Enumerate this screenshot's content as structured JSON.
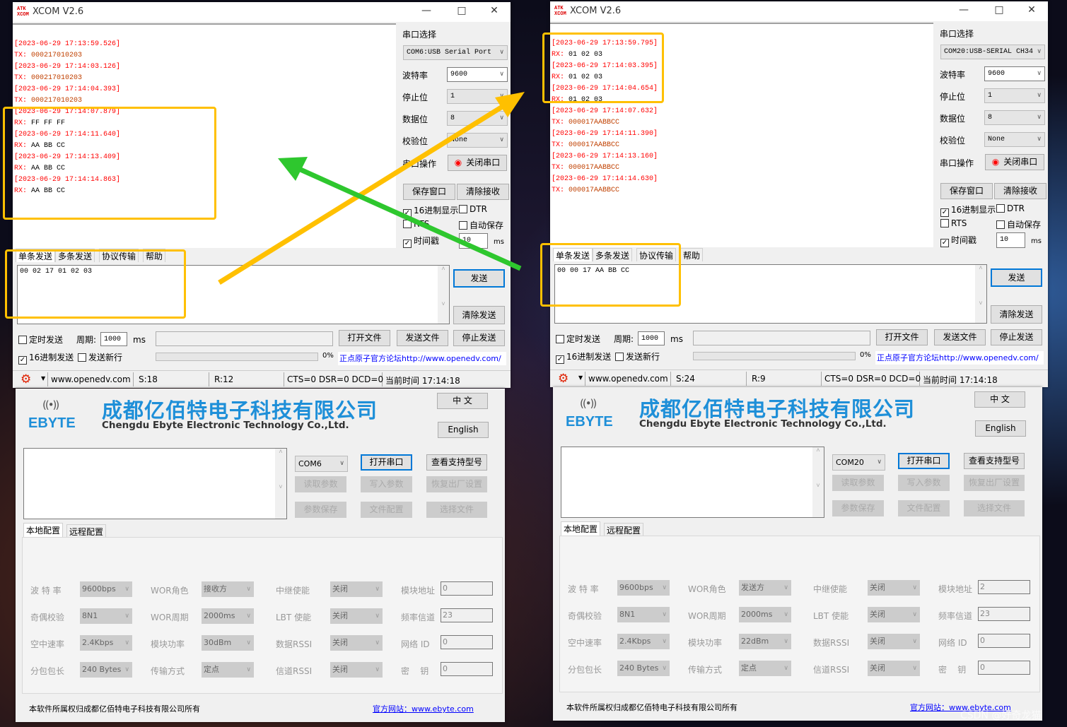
{
  "windows": [
    {
      "xcom": {
        "title": "XCOM V2.6",
        "icon_text": "ATK XCOM",
        "log": [
          {
            "ts": "[2023-06-29 17:13:59.526]",
            "dir": "TX:",
            "payload": "000217010203"
          },
          {
            "ts": "[2023-06-29 17:14:03.126]",
            "dir": "TX:",
            "payload": "000217010203"
          },
          {
            "ts": "[2023-06-29 17:14:04.393]",
            "dir": "TX:",
            "payload": "000217010203"
          },
          {
            "ts": "[2023-06-29 17:14:07.879]",
            "dir": "RX:",
            "payload": "FF FF FF"
          },
          {
            "ts": "[2023-06-29 17:14:11.640]",
            "dir": "RX:",
            "payload": "AA BB CC"
          },
          {
            "ts": "[2023-06-29 17:14:13.409]",
            "dir": "RX:",
            "payload": "AA BB CC"
          },
          {
            "ts": "[2023-06-29 17:14:14.863]",
            "dir": "RX:",
            "payload": "AA BB CC"
          }
        ],
        "panel": {
          "port_label": "串口选择",
          "port": "COM6:USB Serial Port",
          "baud_label": "波特率",
          "baud": "9600",
          "stop_label": "停止位",
          "stop": "1",
          "data_label": "数据位",
          "data": "8",
          "parity_label": "校验位",
          "parity": "None",
          "op_label": "串口操作",
          "op_button": "关闭串口",
          "save_window": "保存窗口",
          "clear_recv": "清除接收",
          "hex_display": "16进制显示",
          "dtr": "DTR",
          "rts": "RTS",
          "auto_save": "自动保存",
          "timestamp": "时间戳",
          "interval": "10",
          "ms": "ms"
        },
        "tabs": [
          "单条发送",
          "多条发送",
          "协议传输",
          "帮助"
        ],
        "send_text": "00 02 17 01 02 03",
        "send_button": "发送",
        "clear_send": "清除发送",
        "timed_send": "定时发送",
        "period_label": "周期:",
        "period": "1000",
        "period_unit": "ms",
        "open_file": "打开文件",
        "send_file": "发送文件",
        "stop_send": "停止发送",
        "hex_send": "16进制发送",
        "send_newline": "发送新行",
        "progress": "0%",
        "forum_link": "正点原子官方论坛http://www.openedv.com/",
        "status": {
          "site": "www.openedv.com",
          "sent": "S:18",
          "recv": "R:12",
          "lines": "CTS=0 DSR=0 DCD=0",
          "time": "当前时间 17:14:18"
        }
      },
      "ebyte": {
        "logo": "EBYTE",
        "company_cn": "成都亿佰特电子科技有限公司",
        "company_en": "Chengdu Ebyte Electronic Technology Co.,Ltd.",
        "lang_cn": "中 文",
        "lang_en": "English",
        "com": "COM6",
        "open_port": "打开串口",
        "view_models": "查看支持型号",
        "read_params": "读取参数",
        "write_params": "写入参数",
        "factory_reset": "恢复出厂设置",
        "save_params": "参数保存",
        "file_config": "文件配置",
        "select_file": "选择文件",
        "tabs": [
          "本地配置",
          "远程配置"
        ],
        "grid": [
          [
            {
              "label": "波 特 率",
              "value": "9600bps"
            },
            {
              "label": "WOR角色",
              "value": "接收方"
            },
            {
              "label": "中继使能",
              "value": "关闭"
            },
            {
              "label": "模块地址",
              "input": "0"
            }
          ],
          [
            {
              "label": "奇偶校验",
              "value": "8N1"
            },
            {
              "label": "WOR周期",
              "value": "2000ms"
            },
            {
              "label": "LBT 使能",
              "value": "关闭"
            },
            {
              "label": "频率信道",
              "input": "23"
            }
          ],
          [
            {
              "label": "空中速率",
              "value": "2.4Kbps"
            },
            {
              "label": "模块功率",
              "value": "30dBm"
            },
            {
              "label": "数据RSSI",
              "value": "关闭"
            },
            {
              "label": "网络 ID",
              "input": "0"
            }
          ],
          [
            {
              "label": "分包包长",
              "value": "240 Bytes"
            },
            {
              "label": "传输方式",
              "value": "定点"
            },
            {
              "label": "信道RSSI",
              "value": "关闭"
            },
            {
              "label": "密    钥",
              "input": "0"
            }
          ]
        ],
        "footer": "本软件所属权归成都亿佰特电子科技有限公司所有",
        "website": "官方网站：www.ebyte.com"
      }
    },
    {
      "xcom": {
        "title": "XCOM V2.6",
        "icon_text": "ATK XCOM",
        "log": [
          {
            "ts": "[2023-06-29 17:13:59.795]",
            "dir": "RX:",
            "payload": "01 02 03"
          },
          {
            "ts": "[2023-06-29 17:14:03.395]",
            "dir": "RX:",
            "payload": "01 02 03"
          },
          {
            "ts": "[2023-06-29 17:14:04.654]",
            "dir": "RX:",
            "payload": "01 02 03"
          },
          {
            "ts": "[2023-06-29 17:14:07.632]",
            "dir": "TX:",
            "payload": "000017AABBCC"
          },
          {
            "ts": "[2023-06-29 17:14:11.390]",
            "dir": "TX:",
            "payload": "000017AABBCC"
          },
          {
            "ts": "[2023-06-29 17:14:13.160]",
            "dir": "TX:",
            "payload": "000017AABBCC"
          },
          {
            "ts": "[2023-06-29 17:14:14.630]",
            "dir": "TX:",
            "payload": "000017AABBCC"
          }
        ],
        "panel": {
          "port_label": "串口选择",
          "port": "COM20:USB-SERIAL CH34",
          "baud_label": "波特率",
          "baud": "9600",
          "stop_label": "停止位",
          "stop": "1",
          "data_label": "数据位",
          "data": "8",
          "parity_label": "校验位",
          "parity": "None",
          "op_label": "串口操作",
          "op_button": "关闭串口",
          "save_window": "保存窗口",
          "clear_recv": "清除接收",
          "hex_display": "16进制显示",
          "dtr": "DTR",
          "rts": "RTS",
          "auto_save": "自动保存",
          "timestamp": "时间戳",
          "interval": "10",
          "ms": "ms"
        },
        "tabs": [
          "单条发送",
          "多条发送",
          "协议传输",
          "帮助"
        ],
        "send_text": "00 00 17 AA BB CC",
        "send_button": "发送",
        "clear_send": "清除发送",
        "timed_send": "定时发送",
        "period_label": "周期:",
        "period": "1000",
        "period_unit": "ms",
        "open_file": "打开文件",
        "send_file": "发送文件",
        "stop_send": "停止发送",
        "hex_send": "16进制发送",
        "send_newline": "发送新行",
        "progress": "0%",
        "forum_link": "正点原子官方论坛http://www.openedv.com/",
        "status": {
          "site": "www.openedv.com",
          "sent": "S:24",
          "recv": "R:9",
          "lines": "CTS=0 DSR=0 DCD=0",
          "time": "当前时间 17:14:18"
        }
      },
      "ebyte": {
        "logo": "EBYTE",
        "company_cn": "成都亿佰特电子科技有限公司",
        "company_en": "Chengdu Ebyte Electronic Technology Co.,Ltd.",
        "lang_cn": "中 文",
        "lang_en": "English",
        "com": "COM20",
        "open_port": "打开串口",
        "view_models": "查看支持型号",
        "read_params": "读取参数",
        "write_params": "写入参数",
        "factory_reset": "恢复出厂设置",
        "save_params": "参数保存",
        "file_config": "文件配置",
        "select_file": "选择文件",
        "tabs": [
          "本地配置",
          "远程配置"
        ],
        "grid": [
          [
            {
              "label": "波 特 率",
              "value": "9600bps"
            },
            {
              "label": "WOR角色",
              "value": "发送方"
            },
            {
              "label": "中继使能",
              "value": "关闭"
            },
            {
              "label": "模块地址",
              "input": "2"
            }
          ],
          [
            {
              "label": "奇偶校验",
              "value": "8N1"
            },
            {
              "label": "WOR周期",
              "value": "2000ms"
            },
            {
              "label": "LBT 使能",
              "value": "关闭"
            },
            {
              "label": "频率信道",
              "input": "23"
            }
          ],
          [
            {
              "label": "空中速率",
              "value": "2.4Kbps"
            },
            {
              "label": "模块功率",
              "value": "22dBm"
            },
            {
              "label": "数据RSSI",
              "value": "关闭"
            },
            {
              "label": "网络 ID",
              "input": "0"
            }
          ],
          [
            {
              "label": "分包包长",
              "value": "240 Bytes"
            },
            {
              "label": "传输方式",
              "value": "定点"
            },
            {
              "label": "信道RSSI",
              "value": "关闭"
            },
            {
              "label": "密    钥",
              "input": "0"
            }
          ]
        ],
        "footer": "本软件所属权归成都亿佰特电子科技有限公司所有",
        "website": "官方网站：www.ebyte.com"
      }
    }
  ],
  "colors": {
    "highlight_box": "#ffc000",
    "arrow_yellow": "#ffc000",
    "arrow_green": "#2ec72e",
    "log_timestamp": "#ff0000",
    "log_tx_payload": "#c04000",
    "ebyte_blue": "#1e8fd8"
  },
  "watermark": "CSDN @好奇龙猫"
}
